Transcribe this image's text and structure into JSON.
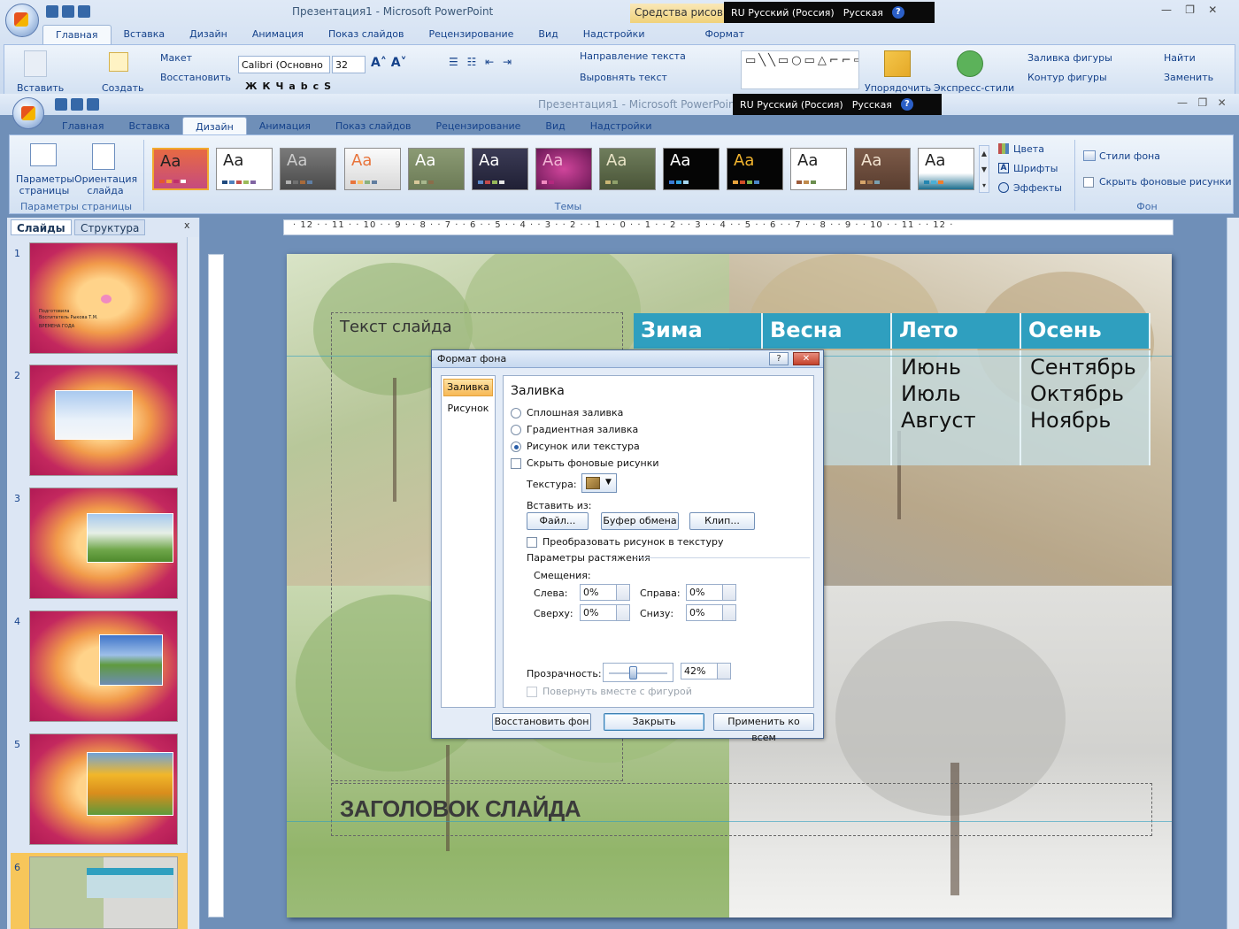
{
  "back_window": {
    "title": "Презентация1 - Microsoft PowerPoint",
    "context_tab": "Средства рисов",
    "tabs": [
      "Главная",
      "Вставка",
      "Дизайн",
      "Анимация",
      "Показ слайдов",
      "Рецензирование",
      "Вид",
      "Надстройки"
    ],
    "context_subtab": "Формат",
    "active_tab": "Главная",
    "clipboard": {
      "paste": "Вставить",
      "create": "Создать",
      "layout": "Макет",
      "restore": "Восстановить"
    },
    "font": {
      "name": "Calibri (Основно",
      "size": "32"
    },
    "para": {
      "text_direction": "Направление текста",
      "align_text": "Выровнять текст"
    },
    "drawing": {
      "arrange": "Упорядочить",
      "quick_styles": "Экспресс-стили",
      "fill": "Заливка фигуры",
      "outline": "Контур фигуры"
    },
    "editing": {
      "find": "Найти",
      "replace": "Заменить"
    }
  },
  "lang_bar": {
    "lang": "RU Русский (Россия)",
    "keyboard": "Русская",
    "help": "?"
  },
  "front_window": {
    "title": "Презентация1 - Microsoft PowerPoint",
    "tabs": [
      "Главная",
      "Вставка",
      "Дизайн",
      "Анимация",
      "Показ слайдов",
      "Рецензирование",
      "Вид",
      "Надстройки"
    ],
    "active_tab": "Дизайн",
    "page_setup": {
      "setup": "Параметры страницы",
      "orientation": "Ориентация слайда",
      "group": "Параметры страницы"
    },
    "themes": {
      "sample": "Aa",
      "group": "Темы",
      "colors": "Цвета",
      "fonts": "Шрифты",
      "effects": "Эффекты"
    },
    "background": {
      "styles": "Стили фона",
      "hide": "Скрыть фоновые рисунки",
      "group": "Фон"
    }
  },
  "left_pane": {
    "tabs": [
      "Слайды",
      "Структура"
    ],
    "close": "x",
    "slides": [
      {
        "num": "1",
        "lines": [
          "Подготовила",
          "Воспитатель Рыкова Т.М.",
          "ВРЕМЕНА  ГОДА"
        ]
      },
      {
        "num": "2"
      },
      {
        "num": "3"
      },
      {
        "num": "4"
      },
      {
        "num": "5"
      },
      {
        "num": "6"
      }
    ]
  },
  "ruler": {
    "ticks": "· 12 · · 11 · · 10 · · 9 · · 8 · · 7 · · 6 · · 5 · · 4 · · 3 · · 2 · · 1 · · 0 · · 1 · · 2 · · 3 · · 4 · · 5 · · 6 · · 7 · · 8 · · 9 · · 10 · · 11 · · 12 ·"
  },
  "slide": {
    "text_placeholder": "Текст слайда",
    "title_placeholder": "ЗАГОЛОВОК СЛАЙДА",
    "table": {
      "headers": [
        "Зима",
        "Весна",
        "Лето",
        "Осень"
      ],
      "cells": [
        "",
        "ль",
        "Июнь\nИюль\nАвгуст",
        "Сентябрь\nОктябрь\nНоябрь"
      ]
    }
  },
  "dialog": {
    "title": "Формат фона",
    "nav": [
      "Заливка",
      "Рисунок"
    ],
    "section": "Заливка",
    "options": [
      "Сплошная заливка",
      "Градиентная заливка",
      "Рисунок или текстура",
      "Скрыть фоновые рисунки"
    ],
    "selected_option": "Рисунок или текстура",
    "texture_label": "Текстура:",
    "insert_from": "Вставить из:",
    "buttons_insert": [
      "Файл...",
      "Буфер обмена",
      "Клип..."
    ],
    "convert": "Преобразовать рисунок в текстуру",
    "stretch": "Параметры растяжения",
    "offsets": "Смещения:",
    "left": {
      "label": "Слева:",
      "value": "0%"
    },
    "right": {
      "label": "Справа:",
      "value": "0%"
    },
    "top": {
      "label": "Сверху:",
      "value": "0%"
    },
    "bottom": {
      "label": "Снизу:",
      "value": "0%"
    },
    "transparency": {
      "label": "Прозрачность:",
      "value": "42%",
      "fraction": 0.42
    },
    "rotate": "Повернуть вместе с фигурой",
    "footer": [
      "Восстановить фон",
      "Закрыть",
      "Применить ко всем"
    ]
  }
}
